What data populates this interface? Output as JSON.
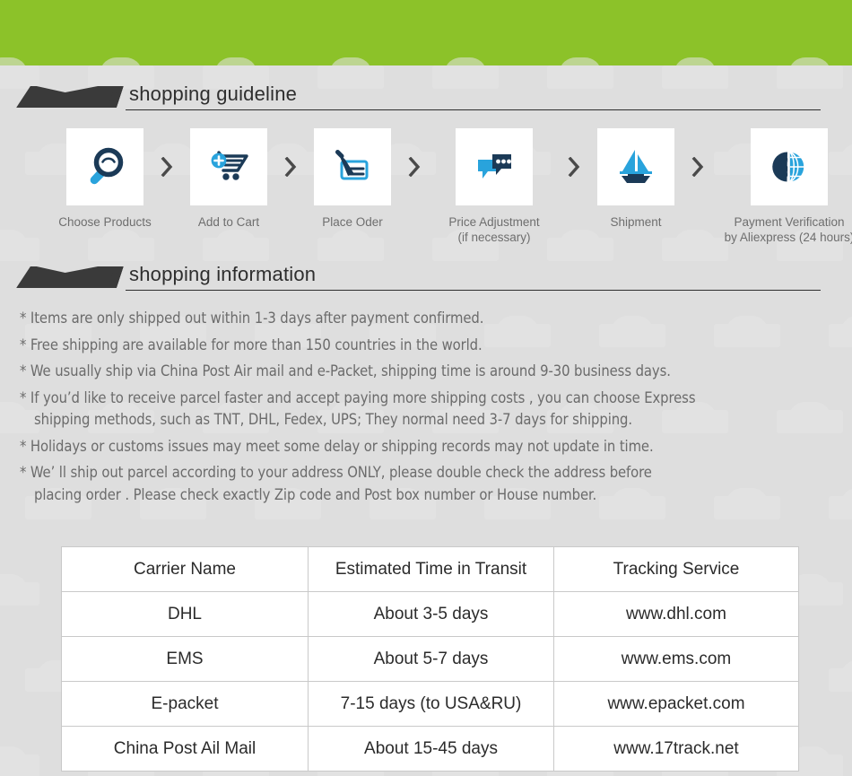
{
  "theme": {
    "banner_green": "#8cc229",
    "page_background": "#dedede",
    "heading_dark": "#3a3a3a",
    "icon_navy": "#1b3a57",
    "icon_blue": "#29a3dc",
    "text_gray": "#6b6b6b",
    "table_border": "#c9c9c9"
  },
  "sections": {
    "guideline": {
      "title": "shopping guideline"
    },
    "information": {
      "title": "shopping information"
    }
  },
  "steps": [
    {
      "icon": "magnifier-icon",
      "label": "Choose Products"
    },
    {
      "icon": "add-to-cart-icon",
      "label": "Add to Cart"
    },
    {
      "icon": "pen-order-icon",
      "label": "Place Oder"
    },
    {
      "icon": "chat-bubbles-icon",
      "label": "Price Adjustment\n(if necessary)"
    },
    {
      "icon": "sailboat-icon",
      "label": "Shipment"
    },
    {
      "icon": "dollar-globe-icon",
      "label": "Payment Verification\nby  Aliexpress (24 hours)"
    }
  ],
  "separator_icon": "chevron-right-icon",
  "info_lines": [
    {
      "text": "* Items are only shipped out within 1-3 days after payment confirmed.",
      "continuation": false
    },
    {
      "text": "* Free shipping are available for more than 150 countries in the world.",
      "continuation": false
    },
    {
      "text": "* We usually ship via China Post Air mail and e-Packet, shipping time is around 9-30 business days.",
      "continuation": false
    },
    {
      "text": "* If you’d like to receive parcel faster and accept paying more shipping costs , you can choose Express",
      "continuation": false
    },
    {
      "text": "shipping methods, such as TNT, DHL, Fedex, UPS; They normal need 3-7 days for shipping.",
      "continuation": true
    },
    {
      "text": "* Holidays or customs issues may meet some delay or shipping records may not update in time.",
      "continuation": false
    },
    {
      "text": "* We’ ll ship out parcel according to your address ONLY, please double check the address before",
      "continuation": false
    },
    {
      "text": "placing order . Please check exactly Zip code and Post box number or House number.",
      "continuation": true
    }
  ],
  "carrier_table": {
    "headers": [
      "Carrier Name",
      "Estimated Time in Transit",
      "Tracking Service"
    ],
    "rows": [
      [
        "DHL",
        "About 3-5 days",
        "www.dhl.com"
      ],
      [
        "EMS",
        "About 5-7 days",
        "www.ems.com"
      ],
      [
        "E-packet",
        "7-15 days (to USA&RU)",
        "www.epacket.com"
      ],
      [
        "China Post Ail Mail",
        "About 15-45 days",
        "www.17track.net"
      ]
    ]
  }
}
